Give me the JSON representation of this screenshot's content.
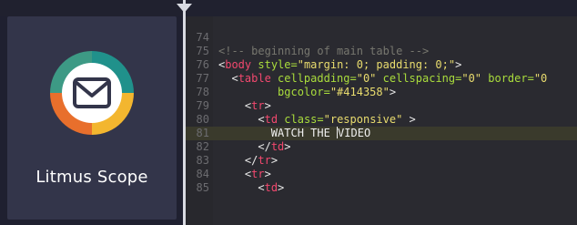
{
  "logo": {
    "name": "Litmus Scope",
    "colors": {
      "green": "#3d9a85",
      "teal": "#20918b",
      "orange": "#e86f2c",
      "yellow": "#f3b62f"
    },
    "icon": "envelope-icon"
  },
  "editor": {
    "colors": {
      "tag": "#f2486e",
      "attr": "#a9dc3c",
      "string": "#e9dc6e",
      "comment": "#77776f"
    },
    "lines": [
      {
        "n": "74"
      },
      {
        "n": "75",
        "comment": "<!-- beginning of main table -->"
      },
      {
        "n": "76",
        "open": "<",
        "tag": "body",
        "attr": " style=",
        "value": "\"margin: 0; padding: 0;\"",
        "close": ">"
      },
      {
        "n": "77",
        "indent": "  ",
        "open": "<",
        "tag": "table",
        "attr": " cellpadding=",
        "value": "\"0\"",
        "attr2": " cellspacing=",
        "value2": "\"0\"",
        "attr3": " border=",
        "value3": "\"0"
      },
      {
        "n": "78",
        "indent": "         ",
        "attr": "bgcolor=",
        "value": "\"#414358\"",
        "close": ">"
      },
      {
        "n": "79",
        "indent": "    ",
        "open": "<",
        "tag": "tr",
        "close": ">"
      },
      {
        "n": "80",
        "indent": "      ",
        "open": "<",
        "tag": "td",
        "attr": " class=",
        "value": "\"responsive\"",
        "close": " >"
      },
      {
        "n": "81",
        "indent": "        ",
        "text_before": "WATCH THE ",
        "text_after": "VIDEO"
      },
      {
        "n": "82",
        "indent": "      ",
        "open": "</",
        "tag": "td",
        "close": ">"
      },
      {
        "n": "83",
        "indent": "    ",
        "open": "</",
        "tag": "tr",
        "close": ">"
      },
      {
        "n": "84",
        "indent": "    ",
        "open": "<",
        "tag": "tr",
        "close": ">"
      },
      {
        "n": "85",
        "indent": "      ",
        "open": "<",
        "tag": "td",
        "close": ">"
      }
    ]
  }
}
